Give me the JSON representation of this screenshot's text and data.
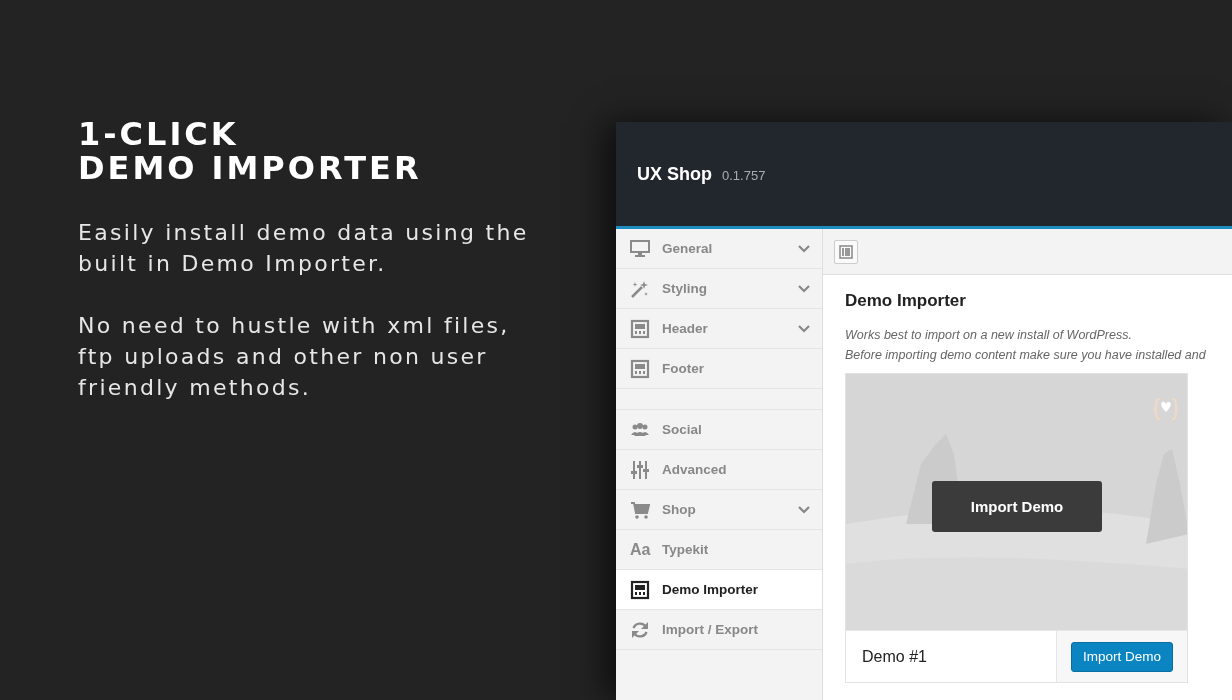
{
  "promo": {
    "title_lines": [
      "1-CLICK",
      "DEMO IMPORTER"
    ],
    "paragraphs": [
      "Easily install demo data using the built in Demo Importer.",
      "No need to hustle with xml files, ftp uploads and other non user friendly methods."
    ]
  },
  "app": {
    "name": "UX Shop",
    "version": "0.1.757"
  },
  "sidebar": {
    "groups": [
      [
        {
          "kind": "monitor",
          "label": "General",
          "expandable": true,
          "selected": false
        },
        {
          "kind": "wand",
          "label": "Styling",
          "expandable": true,
          "selected": false
        },
        {
          "kind": "layout",
          "label": "Header",
          "expandable": true,
          "selected": false
        },
        {
          "kind": "layout",
          "label": "Footer",
          "expandable": false,
          "selected": false
        }
      ],
      [
        {
          "kind": "users",
          "label": "Social",
          "expandable": false,
          "selected": false
        },
        {
          "kind": "sliders",
          "label": "Advanced",
          "expandable": false,
          "selected": false
        },
        {
          "kind": "cart",
          "label": "Shop",
          "expandable": true,
          "selected": false
        },
        {
          "kind": "glyph",
          "glyph": "Aa",
          "label": "Typekit",
          "expandable": false,
          "selected": false
        },
        {
          "kind": "layout",
          "label": "Demo Importer",
          "expandable": false,
          "selected": true
        },
        {
          "kind": "refresh",
          "label": "Import / Export",
          "expandable": false,
          "selected": false
        }
      ]
    ]
  },
  "content": {
    "heading": "Demo Importer",
    "notes": [
      "Works best to import on a new install of WordPress.",
      "Before importing demo content make sure you have installed and"
    ],
    "demos": [
      {
        "kind": "picture",
        "overlay_button": "Import Demo",
        "name": "Demo #1",
        "button": "Import Demo"
      }
    ]
  }
}
